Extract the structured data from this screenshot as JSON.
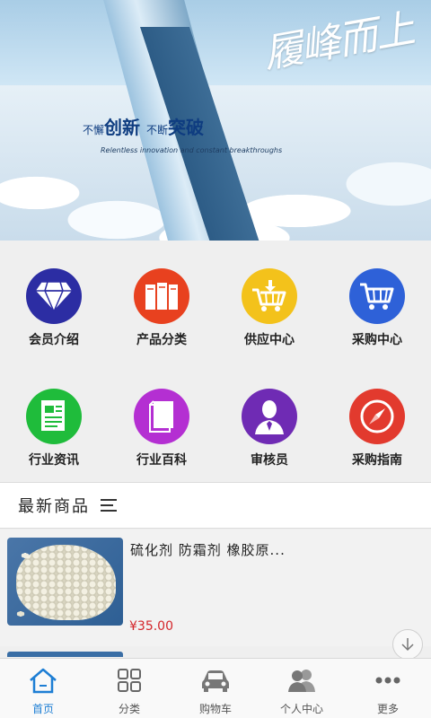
{
  "banner": {
    "calligraphy": "履峰而上",
    "slogan_part1_small": "不懈",
    "slogan_part1_big": "创新",
    "slogan_part2_small": "不断",
    "slogan_part2_big": "突破",
    "slogan_en": "Relentless innovation and constant breakthroughs"
  },
  "grid": {
    "items": [
      {
        "label": "会员介绍",
        "icon": "diamond-icon",
        "color": "#2c2da3"
      },
      {
        "label": "产品分类",
        "icon": "server-icon",
        "color": "#e8411f"
      },
      {
        "label": "供应中心",
        "icon": "cart-download-icon",
        "color": "#f3c21b"
      },
      {
        "label": "采购中心",
        "icon": "cart-icon",
        "color": "#2e61d8"
      },
      {
        "label": "行业资讯",
        "icon": "news-icon",
        "color": "#1fbc3b"
      },
      {
        "label": "行业百科",
        "icon": "book-icon",
        "color": "#b42fd2"
      },
      {
        "label": "审核员",
        "icon": "person-icon",
        "color": "#6f2bb4"
      },
      {
        "label": "采购指南",
        "icon": "compass-icon",
        "color": "#e23a2e"
      }
    ]
  },
  "section": {
    "title": "最新商品"
  },
  "product": {
    "name": "硫化剂 防霜剂 橡胶原...",
    "price": "¥35.00"
  },
  "nav": {
    "items": [
      {
        "label": "首页",
        "icon": "home-icon",
        "active": true
      },
      {
        "label": "分类",
        "icon": "grid-icon",
        "active": false
      },
      {
        "label": "购物车",
        "icon": "car-icon",
        "active": false
      },
      {
        "label": "个人中心",
        "icon": "users-icon",
        "active": false
      },
      {
        "label": "更多",
        "icon": "more-icon",
        "active": false
      }
    ]
  },
  "colors": {
    "accent": "#1d7ed4",
    "price": "#d4262b"
  }
}
